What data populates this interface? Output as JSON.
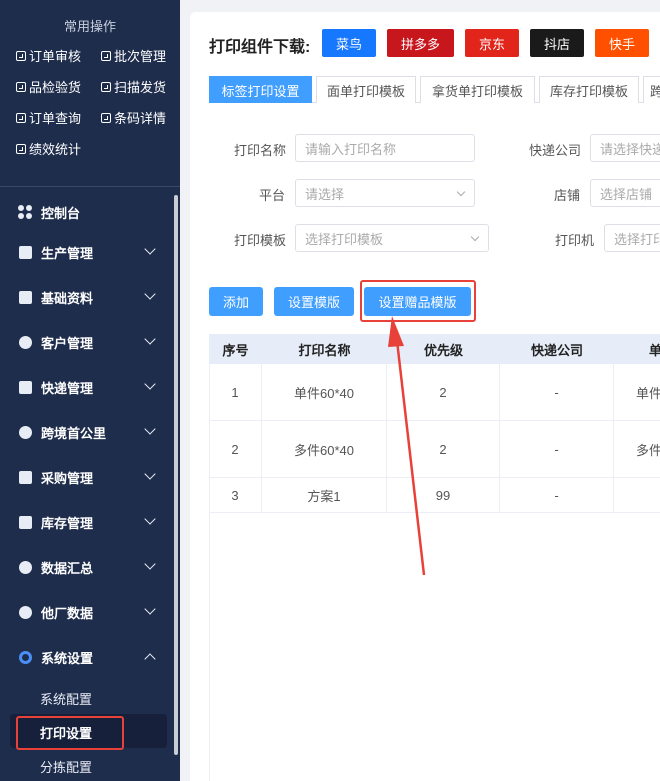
{
  "sidebar": {
    "common_title": "常用操作",
    "quick_actions": [
      {
        "label": "订单审核",
        "icon": "checkbox-icon"
      },
      {
        "label": "批次管理",
        "icon": "copy-icon"
      },
      {
        "label": "品检验货",
        "icon": "image-icon"
      },
      {
        "label": "扫描发货",
        "icon": "scan-icon"
      },
      {
        "label": "订单查询",
        "icon": "search-doc-icon"
      },
      {
        "label": "条码详情",
        "icon": "barcode-icon"
      },
      {
        "label": "绩效统计",
        "icon": "chart-icon"
      }
    ],
    "menu": [
      {
        "label": "控制台",
        "icon": "dashboard-icon",
        "has_chevron": false
      },
      {
        "label": "生产管理",
        "icon": "production-icon",
        "has_chevron": true
      },
      {
        "label": "基础资料",
        "icon": "database-icon",
        "has_chevron": true
      },
      {
        "label": "客户管理",
        "icon": "users-icon",
        "has_chevron": true
      },
      {
        "label": "快递管理",
        "icon": "calendar-icon",
        "has_chevron": true
      },
      {
        "label": "跨境首公里",
        "icon": "globe-icon",
        "has_chevron": true
      },
      {
        "label": "采购管理",
        "icon": "store-icon",
        "has_chevron": true
      },
      {
        "label": "库存管理",
        "icon": "inventory-icon",
        "has_chevron": true
      },
      {
        "label": "数据汇总",
        "icon": "pie-icon",
        "has_chevron": true
      },
      {
        "label": "他厂数据",
        "icon": "pie2-icon",
        "has_chevron": true
      },
      {
        "label": "系统设置",
        "icon": "settings-ring-icon",
        "has_chevron": true,
        "expanded": true
      }
    ],
    "sub_items": [
      "系统配置",
      "打印设置",
      "分拣配置"
    ],
    "active_sub": "打印设置"
  },
  "main": {
    "download_title": "打印组件下载:",
    "download_buttons": [
      {
        "label": "菜鸟",
        "color": "#1677ff"
      },
      {
        "label": "拼多多",
        "color": "#c8161d"
      },
      {
        "label": "京东",
        "color": "#e1251b"
      },
      {
        "label": "抖店",
        "color": "#1a1a1a"
      },
      {
        "label": "快手",
        "color": "#ff5000"
      }
    ],
    "tabs": [
      "标签打印设置",
      "面单打印模板",
      "拿货单打印模板",
      "库存打印模板",
      "跨"
    ],
    "active_tab": "标签打印设置",
    "form": {
      "print_name_label": "打印名称",
      "print_name_placeholder": "请输入打印名称",
      "courier_label": "快递公司",
      "courier_placeholder": "请选择快递",
      "platform_label": "平台",
      "platform_placeholder": "请选择",
      "shop_label": "店铺",
      "shop_placeholder": "选择店铺",
      "template_label": "打印模板",
      "template_placeholder": "选择打印模板",
      "printer_label": "打印机",
      "printer_placeholder": "选择打印"
    },
    "actions": {
      "add": "添加",
      "set_template": "设置模版",
      "set_gift_template": "设置赠品模版"
    },
    "table": {
      "headers": [
        "序号",
        "打印名称",
        "优先级",
        "快递公司",
        "单"
      ],
      "rows": [
        [
          "1",
          "单件60*40",
          "2",
          "-",
          "单件"
        ],
        [
          "2",
          "多件60*40",
          "2",
          "-",
          "多件"
        ],
        [
          "3",
          "方案1",
          "99",
          "-",
          ""
        ]
      ]
    }
  },
  "colors": {
    "sidebar_bg": "#1f2d4d",
    "accent": "#409eff",
    "highlight": "#e8413a"
  }
}
